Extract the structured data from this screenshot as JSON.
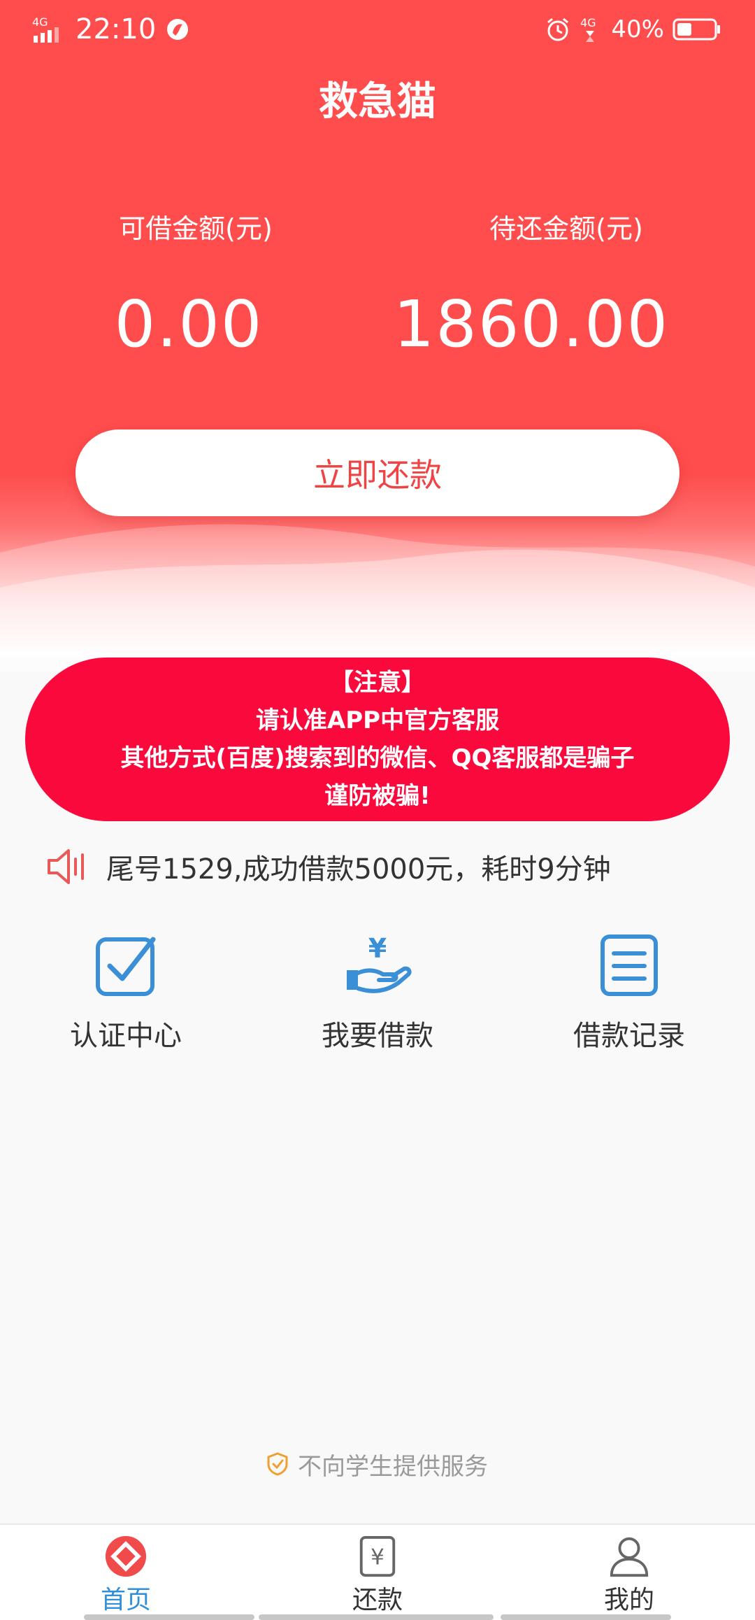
{
  "status_bar": {
    "network": "4G",
    "time": "22:10",
    "right_network": "4G",
    "battery_percent": "40%",
    "battery_level": 0.4
  },
  "header": {
    "title": "救急猫"
  },
  "stats": {
    "available_label": "可借金额(元)",
    "available_value": "0.00",
    "due_label": "待还金额(元)",
    "due_value": "1860.00"
  },
  "repay_button": {
    "label": "立即还款"
  },
  "notice": {
    "lines": [
      "【注意】",
      "请认准APP中官方客服",
      "其他方式(百度)搜索到的微信、QQ客服都是骗子",
      "谨防被骗!"
    ]
  },
  "marquee": {
    "text": "尾号1529,成功借款5000元，耗时9分钟",
    "icon": "speaker-icon"
  },
  "quick_menu": [
    {
      "label": "认证中心",
      "icon": "check-square-icon"
    },
    {
      "label": "我要借款",
      "icon": "yuan-hand-icon"
    },
    {
      "label": "借款记录",
      "icon": "list-doc-icon"
    }
  ],
  "footer_note": {
    "text": "不向学生提供服务",
    "icon": "shield-check-icon"
  },
  "tabs": [
    {
      "label": "首页",
      "icon": "home-diamond-icon",
      "active": true
    },
    {
      "label": "还款",
      "icon": "yuan-doc-icon",
      "active": false
    },
    {
      "label": "我的",
      "icon": "user-icon",
      "active": false
    }
  ],
  "colors": {
    "brand_red": "#ff4c4c",
    "notice_red": "#fa0a3c",
    "icon_blue": "#3a8fd6",
    "active_tab": "#2f8fd8"
  }
}
